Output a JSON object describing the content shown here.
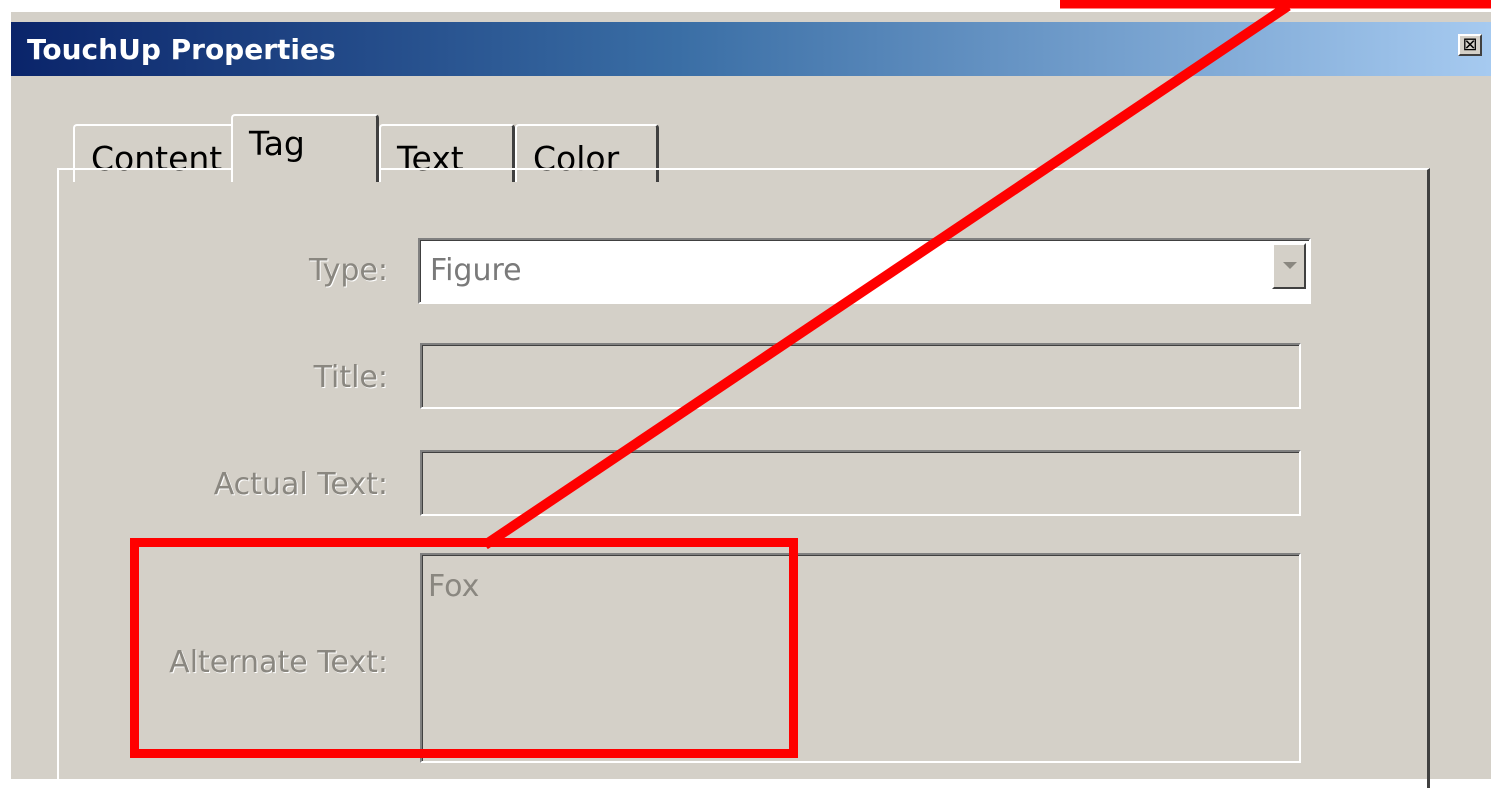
{
  "window": {
    "title": "TouchUp Properties",
    "close_glyph": "⊠"
  },
  "tabs": [
    {
      "label": "Content",
      "active": false
    },
    {
      "label": "Tag",
      "active": true
    },
    {
      "label": "Text",
      "active": false
    },
    {
      "label": "Color",
      "active": false
    }
  ],
  "form": {
    "type": {
      "label": "Type:",
      "value": "Figure"
    },
    "title": {
      "label": "Title:",
      "value": ""
    },
    "actual_text": {
      "label": "Actual Text:",
      "value": ""
    },
    "alternate_text": {
      "label": "Alternate Text:",
      "value": "Fox"
    }
  },
  "annotation": {
    "color": "#ff0000",
    "description_highlight": "alternate text callout"
  },
  "colors": {
    "dialog_bg": "#d4d0c8",
    "title_start": "#0a246a",
    "title_end": "#a6caf0",
    "disabled_text": "#8a8780"
  },
  "icons": {
    "close": "close-icon",
    "dropdown": "chevron-down-icon"
  }
}
